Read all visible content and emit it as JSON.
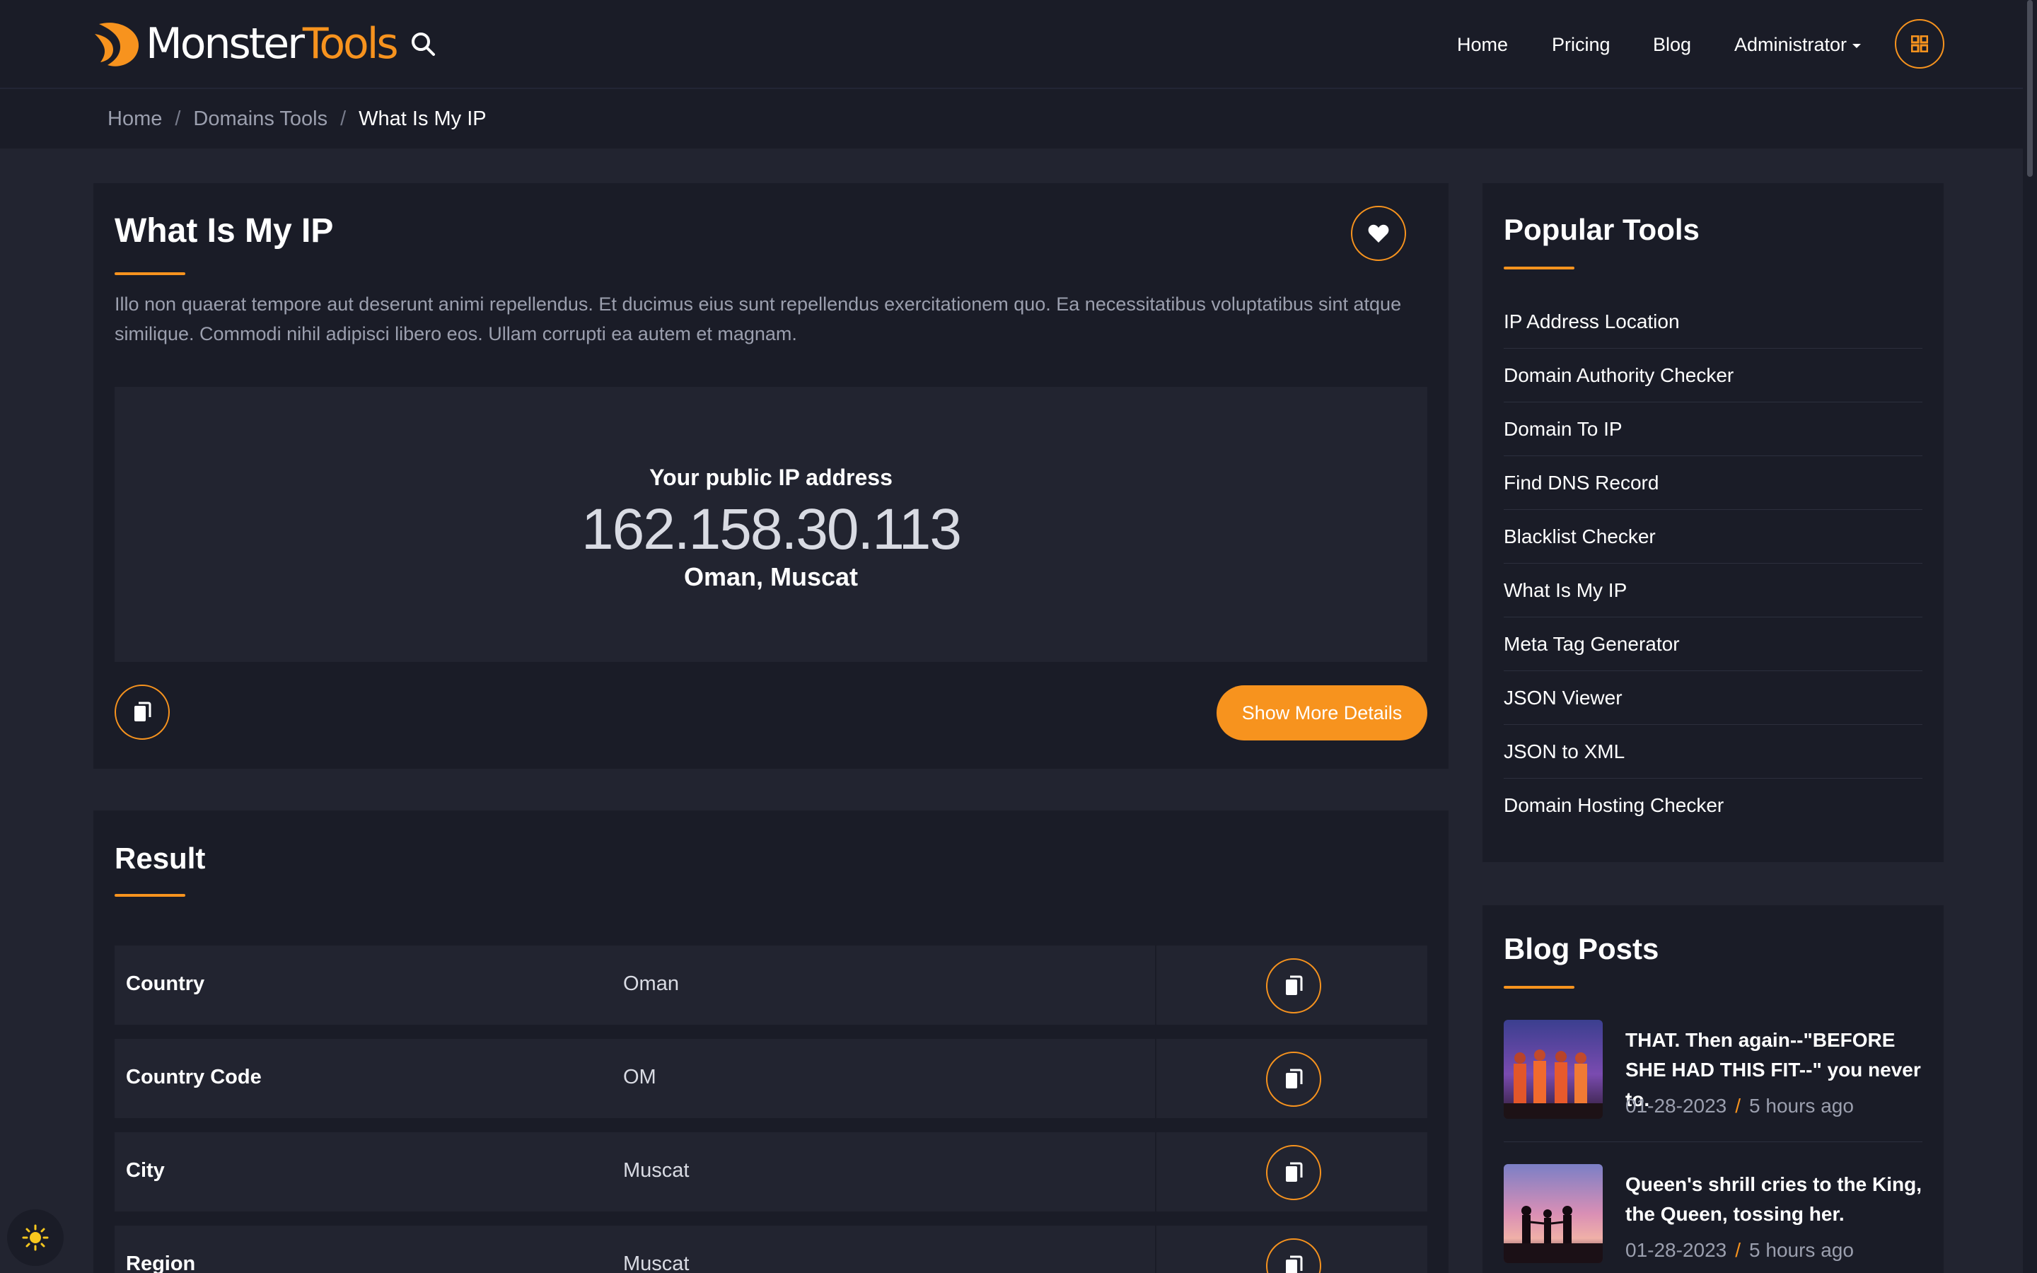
{
  "brand": {
    "name_white": "Monster",
    "name_orange": "Tools"
  },
  "nav": {
    "items": [
      {
        "label": "Home"
      },
      {
        "label": "Pricing"
      },
      {
        "label": "Blog"
      },
      {
        "label": "Administrator"
      }
    ]
  },
  "breadcrumb": [
    "Home",
    "Domains Tools",
    "What Is My IP"
  ],
  "tool": {
    "title": "What Is My IP",
    "description": "Illo non quaerat tempore aut deserunt animi repellendus. Et ducimus eius sunt repellendus exercitationem quo. Ea necessitatibus voluptatibus sint atque similique. Commodi nihil adipisci libero eos. Ullam corrupti ea autem et magnam.",
    "ip_label": "Your public IP address",
    "ip_value": "162.158.30.113",
    "location": "Oman, Muscat",
    "more_button": "Show More Details"
  },
  "result": {
    "title": "Result",
    "rows": [
      {
        "key": "Country",
        "value": "Oman"
      },
      {
        "key": "Country Code",
        "value": "OM"
      },
      {
        "key": "City",
        "value": "Muscat"
      },
      {
        "key": "Region",
        "value": "Muscat"
      }
    ]
  },
  "popular": {
    "title": "Popular Tools",
    "items": [
      "IP Address Location",
      "Domain Authority Checker",
      "Domain To IP",
      "Find DNS Record",
      "Blacklist Checker",
      "What Is My IP",
      "Meta Tag Generator",
      "JSON Viewer",
      "JSON to XML",
      "Domain Hosting Checker"
    ]
  },
  "blog": {
    "title": "Blog Posts",
    "posts": [
      {
        "title": "THAT. Then again--\"BEFORE SHE HAD THIS FIT--\" you never to.",
        "date": "01-28-2023",
        "ago": "5 hours ago"
      },
      {
        "title": "Queen's shrill cries to the King, the Queen, tossing her.",
        "date": "01-28-2023",
        "ago": "5 hours ago"
      }
    ]
  },
  "colors": {
    "accent": "#f7931e",
    "background": "#222430",
    "card": "#1a1c27"
  },
  "icons": {
    "search": "search-icon",
    "apps": "grid-icon",
    "favorite": "heart-icon",
    "copy": "copy-icon",
    "theme": "sun-icon"
  }
}
